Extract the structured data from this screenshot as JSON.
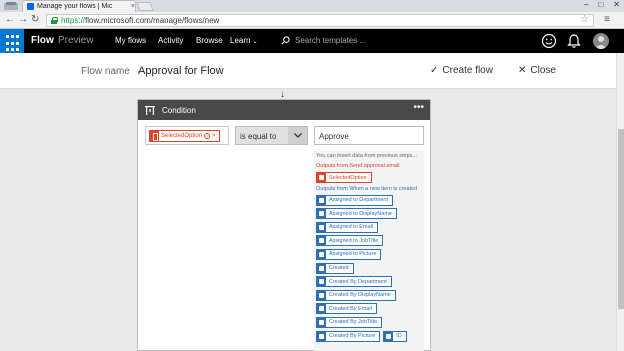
{
  "browser": {
    "tab_title": "Manage your flows | Mic",
    "url_scheme": "https://",
    "url_rest": "flow.microsoft.com/manage/flows/new"
  },
  "appbar": {
    "brand": "Flow",
    "brand_sub": "Preview",
    "nav": [
      "My flows",
      "Activity",
      "Browse",
      "Learn"
    ],
    "search_placeholder": "Search templates ...",
    "accent_color": "#0078d4"
  },
  "subheader": {
    "flow_name_label": "Flow name",
    "flow_name_value": "Approval for Flow",
    "create_label": "Create flow",
    "close_label": "Close"
  },
  "condition": {
    "title": "Condition",
    "left_token": "SelectedOption",
    "operator": "is equal to",
    "value": "Approve"
  },
  "dynamic_content": {
    "hint": "You can insert data from previous steps...",
    "group1_label": "Outputs from Send approval email",
    "group1_tokens": [
      "SelectedOption"
    ],
    "group2_label": "Outputs from When a new item is created",
    "group2_tokens": [
      "Assigned to Department",
      "Assigned to DisplayName",
      "Assigned to Email",
      "Assigned to JobTitle",
      "Assigned to Picture",
      "Created",
      "Created By Department",
      "Created By DisplayName",
      "Created By Email",
      "Created By JobTitle",
      "Created By Picture",
      "ID"
    ]
  }
}
